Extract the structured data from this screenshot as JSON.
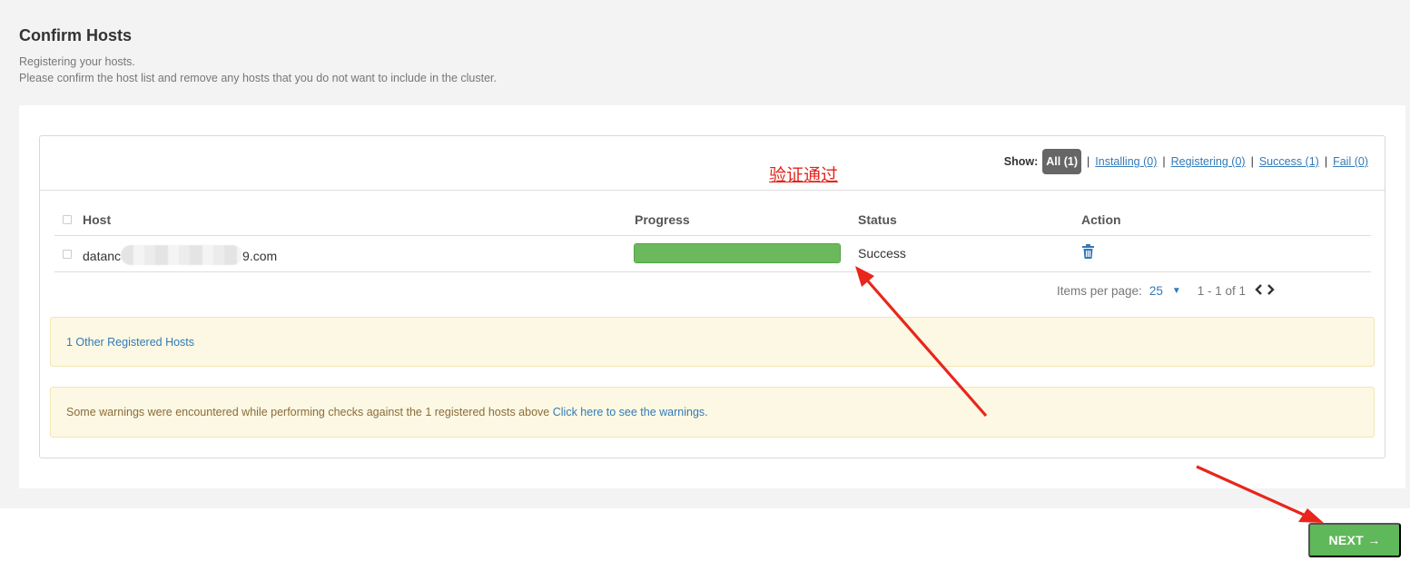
{
  "page": {
    "title": "Confirm Hosts",
    "description_line1": "Registering your hosts.",
    "description_line2": "Please confirm the host list and remove any hosts that you do not want to include in the cluster."
  },
  "filters": {
    "show_label": "Show:",
    "all": "All (1)",
    "separator": "|",
    "installing": "Installing (0)",
    "registering": "Registering (0)",
    "success": "Success (1)",
    "fail": "Fail (0)"
  },
  "table": {
    "headers": {
      "host": "Host",
      "progress": "Progress",
      "status": "Status",
      "action": "Action"
    },
    "rows": [
      {
        "host_prefix": "datanc",
        "host_suffix": "9.com",
        "progress_percent": 100,
        "status": "Success",
        "action_icon": "trash-icon"
      }
    ]
  },
  "pagination": {
    "items_per_page_label": "Items per page:",
    "items_per_page_value": "25",
    "range": "1 - 1 of 1",
    "prev_icon": "‹",
    "next_icon": "›"
  },
  "alerts": {
    "other_hosts": "1 Other Registered Hosts",
    "warnings_text": "Some warnings were encountered while performing checks against the 1 registered hosts above ",
    "warnings_link": "Click here to see the warnings."
  },
  "annotation": {
    "text": "验证通过",
    "color": "#e3241b"
  },
  "footer": {
    "next_label": "NEXT →"
  },
  "colors": {
    "accent": "#337ab7",
    "success_green": "#6cb85c",
    "next_button": "#5fb85a",
    "alert_bg": "#fcf8e3",
    "annotation_red": "#e3241b"
  }
}
